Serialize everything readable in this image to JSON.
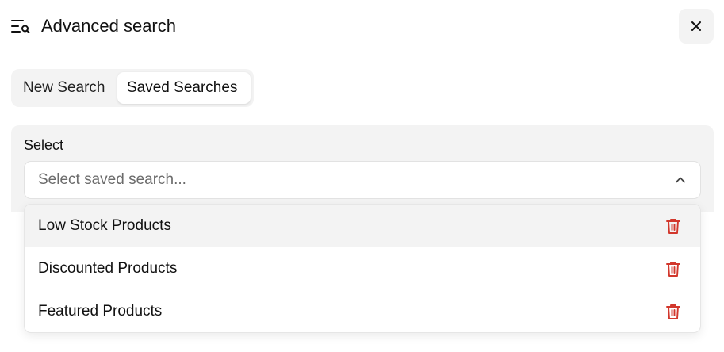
{
  "header": {
    "title": "Advanced search",
    "icon": "search-filter-icon",
    "close_icon": "close-icon"
  },
  "tabs": [
    {
      "label": "New Search",
      "active": false
    },
    {
      "label": "Saved Searches",
      "active": true
    }
  ],
  "select": {
    "label": "Select",
    "placeholder": "Select saved search...",
    "expanded": true,
    "chevron_icon": "chevron-up-icon"
  },
  "saved_searches": [
    {
      "label": "Low Stock Products",
      "highlighted": true,
      "delete_icon": "trash-icon"
    },
    {
      "label": "Discounted Products",
      "highlighted": false,
      "delete_icon": "trash-icon"
    },
    {
      "label": "Featured Products",
      "highlighted": false,
      "delete_icon": "trash-icon"
    }
  ],
  "colors": {
    "delete": "#d2372c",
    "panel_bg": "#f3f3f3",
    "text": "#111111",
    "placeholder": "#6b6b6b"
  }
}
